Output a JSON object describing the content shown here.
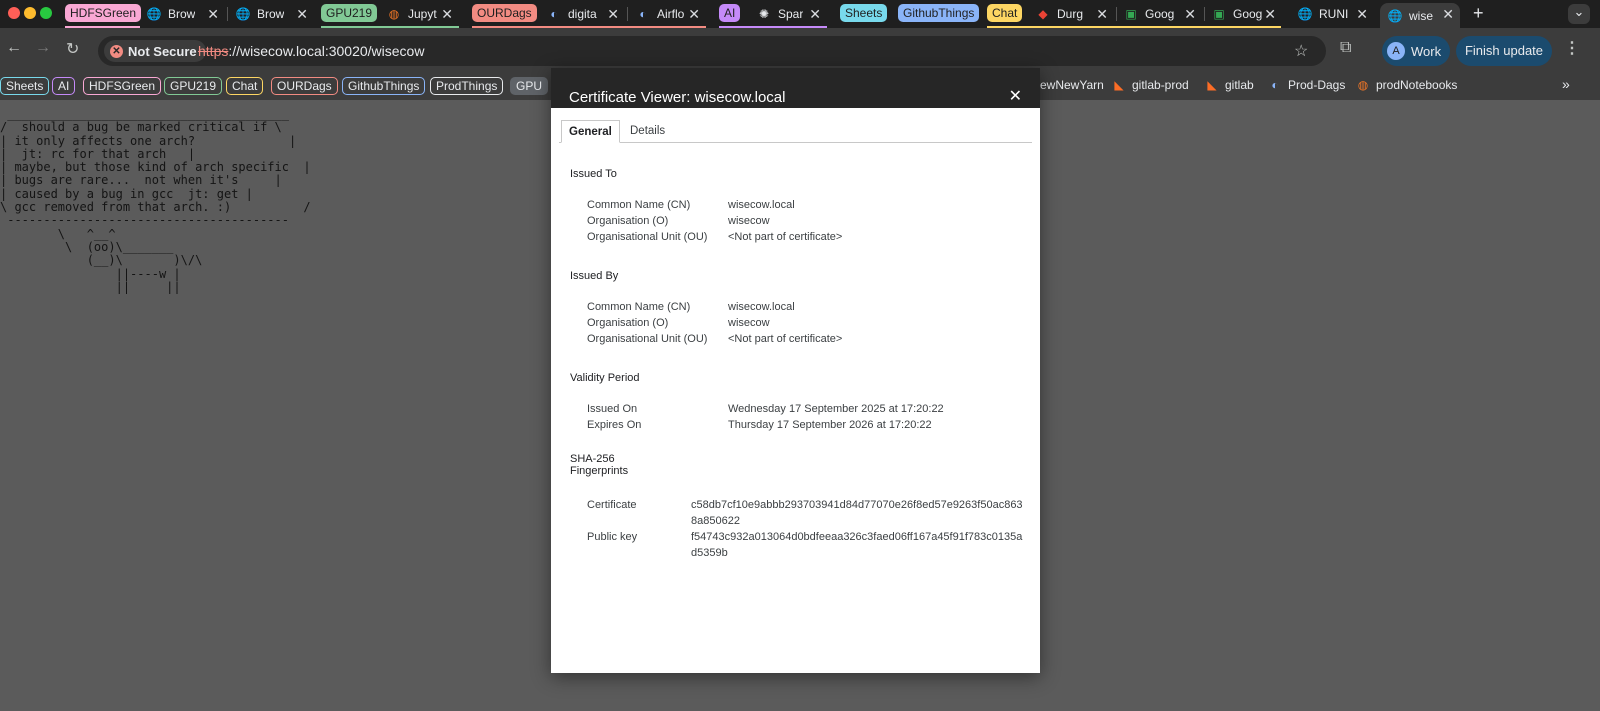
{
  "tabstrip": {
    "groups": [
      {
        "name": "HDFSGreen",
        "color": "#f9a8d4"
      },
      {
        "name": "GPU219",
        "color": "#81c995"
      },
      {
        "name": "OURDags",
        "color": "#f28b82"
      },
      {
        "name": "AI",
        "color": "#c58af9"
      },
      {
        "name": "Sheets",
        "color": "#78d9ec"
      },
      {
        "name": "GithubThings",
        "color": "#8ab4f8"
      },
      {
        "name": "Chat",
        "color": "#fdd663"
      }
    ],
    "tabs": [
      {
        "label": "Brow",
        "icon": "globe-icon"
      },
      {
        "label": "Brow",
        "icon": "globe-icon"
      },
      {
        "label": "Jupyt",
        "icon": "jupyter-icon"
      },
      {
        "label": "digita",
        "icon": "airflow-icon"
      },
      {
        "label": "Airflo",
        "icon": "airflow-icon"
      },
      {
        "label": "Spar",
        "icon": "openai-icon"
      },
      {
        "label": "Durg",
        "icon": "durga-icon"
      },
      {
        "label": "Goog",
        "icon": "google-meet-icon"
      },
      {
        "label": "Goog",
        "icon": "google-meet-icon"
      },
      {
        "label": "RUNI",
        "icon": "globe-icon"
      },
      {
        "label": "wise",
        "icon": "globe-icon"
      }
    ],
    "new_tab": "+",
    "tab_search": "⌄"
  },
  "toolbar": {
    "not_secure": "Not Secure",
    "url_scheme": "https",
    "url_rest": "://wisecow.local:30020/wisecow",
    "profile_initial": "A",
    "profile_label": "Work",
    "update_label": "Finish update"
  },
  "bookmarks": {
    "chips": [
      {
        "label": "Sheets",
        "color": "#78d9ec"
      },
      {
        "label": "AI",
        "color": "#c58af9"
      },
      {
        "label": "HDFSGreen",
        "color": "#f9a8d4"
      },
      {
        "label": "GPU219",
        "color": "#81c995"
      },
      {
        "label": "Chat",
        "color": "#fdd663"
      },
      {
        "label": "OURDags",
        "color": "#f28b82"
      },
      {
        "label": "GithubThings",
        "color": "#8ab4f8"
      },
      {
        "label": "ProdThings",
        "color": "#e8eaed"
      },
      {
        "label": "GPU",
        "color": "#5f6368"
      }
    ],
    "items": [
      {
        "label": "ewNewYarn",
        "icon": ""
      },
      {
        "label": "gitlab-prod",
        "icon": "gitlab-icon"
      },
      {
        "label": "gitlab",
        "icon": "gitlab-icon"
      },
      {
        "label": "Prod-Dags",
        "icon": "airflow-icon"
      },
      {
        "label": "prodNotebooks",
        "icon": "jupyter-icon"
      }
    ],
    "overflow": "»"
  },
  "page": {
    "cowsay": " _______________________________________\n/  should a bug be marked critical if \\\n| it only affects one arch?             |\n|  jt: rc for that arch   |\n| maybe, but those kind of arch specific  |\n| bugs are rare...  not when it's     |\n| caused by a bug in gcc  jt: get |\n\\ gcc removed from that arch. :)          /\n ---------------------------------------\n        \\   ^__^\n         \\  (oo)\\_______\n            (__)\\       )\\/\\\n                ||----w |\n                ||     ||"
  },
  "dialog": {
    "title": "Certificate Viewer: wisecow.local",
    "tabs": [
      "General",
      "Details"
    ],
    "issued_to": {
      "heading": "Issued To",
      "rows": [
        {
          "label": "Common Name (CN)",
          "value": "wisecow.local"
        },
        {
          "label": "Organisation (O)",
          "value": "wisecow"
        },
        {
          "label": "Organisational Unit (OU)",
          "value": "<Not part of certificate>"
        }
      ]
    },
    "issued_by": {
      "heading": "Issued By",
      "rows": [
        {
          "label": "Common Name (CN)",
          "value": "wisecow.local"
        },
        {
          "label": "Organisation (O)",
          "value": "wisecow"
        },
        {
          "label": "Organisational Unit (OU)",
          "value": "<Not part of certificate>"
        }
      ]
    },
    "validity": {
      "heading": "Validity Period",
      "rows": [
        {
          "label": "Issued On",
          "value": "Wednesday 17 September 2025 at 17:20:22"
        },
        {
          "label": "Expires On",
          "value": "Thursday 17 September 2026 at 17:20:22"
        }
      ]
    },
    "fingerprints": {
      "heading_line1": "SHA-256",
      "heading_line2": "Fingerprints",
      "rows": [
        {
          "label": "Certificate",
          "value": "c58db7cf10e9abbb293703941d84d77070e26f8ed57e9263f50ac8638a850622"
        },
        {
          "label": "Public key",
          "value": "f54743c932a013064d0bdfeeaa326c3faed06ff167a45f91f783c0135ad5359b"
        }
      ]
    }
  }
}
